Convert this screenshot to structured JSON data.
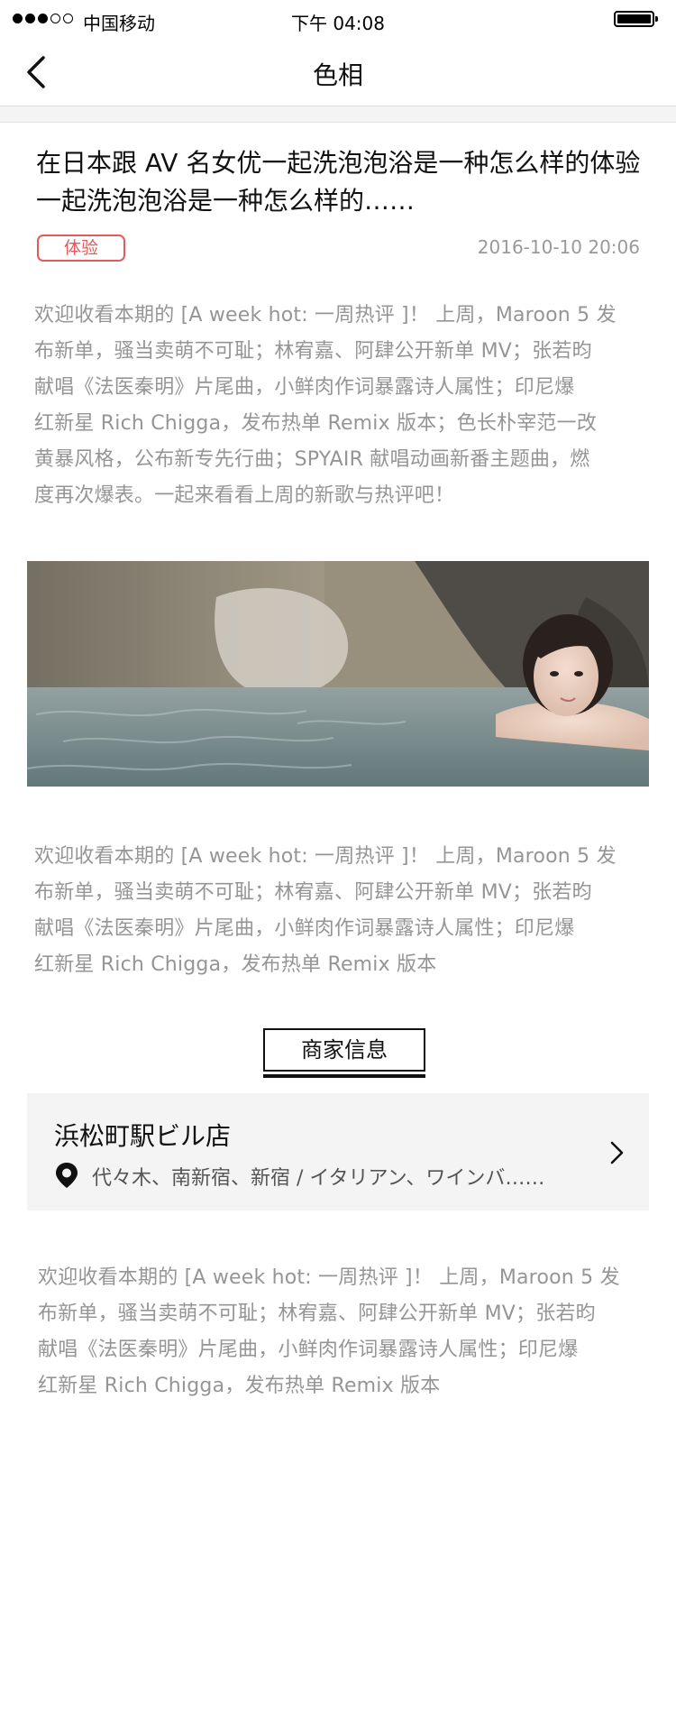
{
  "status_bar": {
    "carrier": "中国移动",
    "time": "下午 04:08",
    "signal_bars_filled": 3,
    "signal_bars_total": 5
  },
  "nav": {
    "title": "色相",
    "back_icon": "chevron-left-icon"
  },
  "article": {
    "title_lines": [
      "在日本跟 AV 名女优一起洗泡泡浴是一种怎么样的体验",
      "一起洗泡泡浴是一种怎么样的……"
    ],
    "tag": "体验",
    "date": "2016-10-10 20:06",
    "paragraphs": [
      [
        "欢迎收看本期的 [A week hot: 一周热评 ]！ 上周，Maroon 5 发",
        "布新单，骚当卖萌不可耻；林宥嘉、阿肆公开新单 MV；张若昀",
        "献唱《法医秦明》片尾曲，小鲜肉作词暴露诗人属性；印尼爆",
        "红新星 Rich Chigga，发布热单 Remix 版本；色长朴宰范一改",
        "黄暴风格，公布新专先行曲；SPYAIR 献唱动画新番主题曲，燃",
        "度再次爆表。一起来看看上周的新歌与热评吧！"
      ],
      [
        "欢迎收看本期的 [A week hot: 一周热评 ]！ 上周，Maroon 5 发",
        "布新单，骚当卖萌不可耻；林宥嘉、阿肆公开新单 MV；张若昀",
        "献唱《法医秦明》片尾曲，小鲜肉作词暴露诗人属性；印尼爆",
        "红新星 Rich Chigga，发布热单 Remix 版本"
      ],
      [
        "欢迎收看本期的 [A week hot: 一周热评 ]！ 上周，Maroon 5 发",
        "布新单，骚当卖萌不可耻；林宥嘉、阿肆公开新单 MV；张若昀",
        "献唱《法医秦明》片尾曲，小鲜肉作词暴露诗人属性；印尼爆",
        "红新星 Rich Chigga，发布热单 Remix 版本"
      ]
    ]
  },
  "merchant": {
    "section_title": "商家信息",
    "name": "浜松町駅ビル店",
    "address": "代々木、南新宿、新宿 / イタリアン、ワインバ……",
    "location_icon": "map-pin-icon",
    "arrow_icon": "chevron-right-icon"
  },
  "colors": {
    "accent_red": "#e25a5a",
    "text_primary": "#111111",
    "text_secondary": "#959595",
    "card_bg": "#f4f4f4"
  }
}
